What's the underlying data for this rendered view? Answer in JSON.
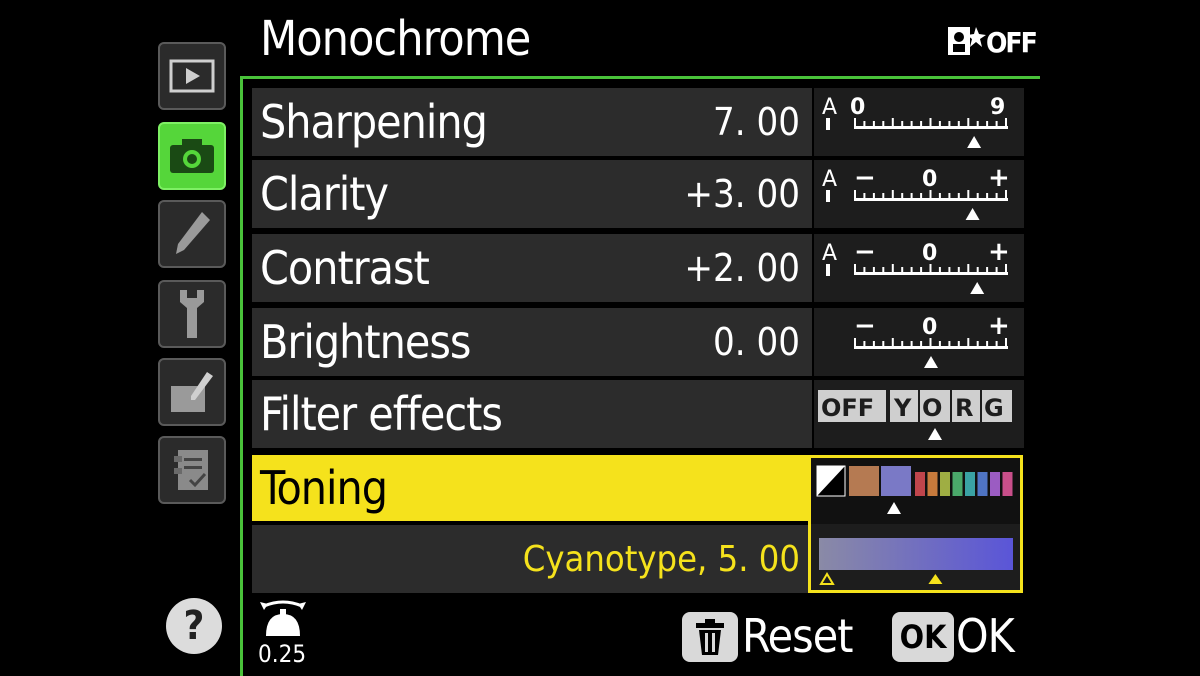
{
  "header": {
    "title": "Monochrome",
    "top_right_icon": "auto-portrait-off-icon",
    "top_right_text": "OFF"
  },
  "sidebar": {
    "items": [
      {
        "icon": "playback-icon",
        "active": false
      },
      {
        "icon": "camera-icon",
        "active": true
      },
      {
        "icon": "pencil-icon",
        "active": false
      },
      {
        "icon": "wrench-icon",
        "active": false
      },
      {
        "icon": "retouch-icon",
        "active": false
      },
      {
        "icon": "my-menu-icon",
        "active": false
      }
    ]
  },
  "settings": [
    {
      "label": "Sharpening",
      "value": "7. 00",
      "scale": {
        "auto": "A",
        "min": "0",
        "max": "9",
        "level": 0.78
      }
    },
    {
      "label": "Clarity",
      "value": "+3. 00",
      "scale": {
        "auto": "A",
        "min": "−",
        "mid": "0",
        "max": "+",
        "level": 0.77
      }
    },
    {
      "label": "Contrast",
      "value": "+2. 00",
      "scale": {
        "auto": "A",
        "min": "−",
        "mid": "0",
        "max": "+",
        "level": 0.8
      }
    },
    {
      "label": "Brightness",
      "value": "0. 00",
      "scale": {
        "min": "−",
        "mid": "0",
        "max": "+",
        "level": 0.5
      }
    },
    {
      "label": "Filter effects",
      "value": "",
      "filters": [
        "OFF",
        "Y",
        "O",
        "R",
        "G"
      ],
      "selected_index": 2
    }
  ],
  "toning": {
    "label": "Toning",
    "sub_value": "Cyanotype, 5. 00",
    "swatches": [
      "#ffffff",
      "#b57a52",
      "#7a79c6"
    ],
    "extra_colors": [
      "#c0454c",
      "#c77a3c",
      "#9fae43",
      "#4aa86a",
      "#3aa2a4",
      "#4f74c4",
      "#9b5cc2",
      "#c94f8a"
    ],
    "selected_swatch": 2,
    "gradient_from": "#8a8aa6",
    "gradient_to": "#5a55d8",
    "strength_level": 0.6
  },
  "footer": {
    "help": "?",
    "step_value": "0.25",
    "reset_label": "Reset",
    "ok_badge": "OK",
    "ok_label": "OK"
  },
  "colors": {
    "accent_green": "#49c23a",
    "highlight_yellow": "#f5e21c",
    "row_bg": "#2c2c2c"
  }
}
